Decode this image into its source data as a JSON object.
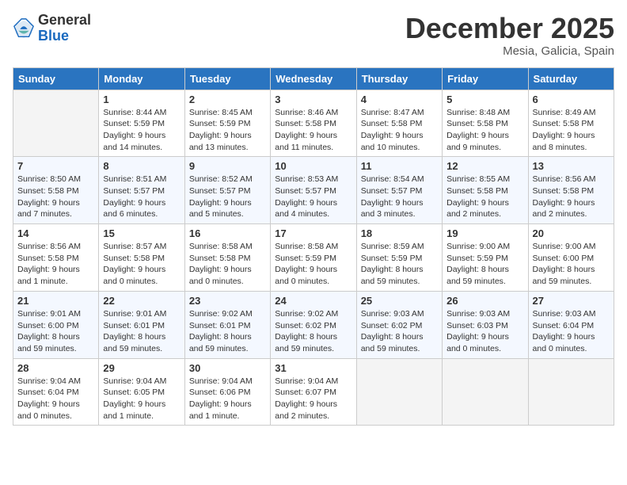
{
  "logo": {
    "general": "General",
    "blue": "Blue"
  },
  "title": "December 2025",
  "location": "Mesia, Galicia, Spain",
  "days_of_week": [
    "Sunday",
    "Monday",
    "Tuesday",
    "Wednesday",
    "Thursday",
    "Friday",
    "Saturday"
  ],
  "weeks": [
    [
      {
        "day": "",
        "info": ""
      },
      {
        "day": "1",
        "info": "Sunrise: 8:44 AM\nSunset: 5:59 PM\nDaylight: 9 hours\nand 14 minutes."
      },
      {
        "day": "2",
        "info": "Sunrise: 8:45 AM\nSunset: 5:59 PM\nDaylight: 9 hours\nand 13 minutes."
      },
      {
        "day": "3",
        "info": "Sunrise: 8:46 AM\nSunset: 5:58 PM\nDaylight: 9 hours\nand 11 minutes."
      },
      {
        "day": "4",
        "info": "Sunrise: 8:47 AM\nSunset: 5:58 PM\nDaylight: 9 hours\nand 10 minutes."
      },
      {
        "day": "5",
        "info": "Sunrise: 8:48 AM\nSunset: 5:58 PM\nDaylight: 9 hours\nand 9 minutes."
      },
      {
        "day": "6",
        "info": "Sunrise: 8:49 AM\nSunset: 5:58 PM\nDaylight: 9 hours\nand 8 minutes."
      }
    ],
    [
      {
        "day": "7",
        "info": "Sunrise: 8:50 AM\nSunset: 5:58 PM\nDaylight: 9 hours\nand 7 minutes."
      },
      {
        "day": "8",
        "info": "Sunrise: 8:51 AM\nSunset: 5:57 PM\nDaylight: 9 hours\nand 6 minutes."
      },
      {
        "day": "9",
        "info": "Sunrise: 8:52 AM\nSunset: 5:57 PM\nDaylight: 9 hours\nand 5 minutes."
      },
      {
        "day": "10",
        "info": "Sunrise: 8:53 AM\nSunset: 5:57 PM\nDaylight: 9 hours\nand 4 minutes."
      },
      {
        "day": "11",
        "info": "Sunrise: 8:54 AM\nSunset: 5:57 PM\nDaylight: 9 hours\nand 3 minutes."
      },
      {
        "day": "12",
        "info": "Sunrise: 8:55 AM\nSunset: 5:58 PM\nDaylight: 9 hours\nand 2 minutes."
      },
      {
        "day": "13",
        "info": "Sunrise: 8:56 AM\nSunset: 5:58 PM\nDaylight: 9 hours\nand 2 minutes."
      }
    ],
    [
      {
        "day": "14",
        "info": "Sunrise: 8:56 AM\nSunset: 5:58 PM\nDaylight: 9 hours\nand 1 minute."
      },
      {
        "day": "15",
        "info": "Sunrise: 8:57 AM\nSunset: 5:58 PM\nDaylight: 9 hours\nand 0 minutes."
      },
      {
        "day": "16",
        "info": "Sunrise: 8:58 AM\nSunset: 5:58 PM\nDaylight: 9 hours\nand 0 minutes."
      },
      {
        "day": "17",
        "info": "Sunrise: 8:58 AM\nSunset: 5:59 PM\nDaylight: 9 hours\nand 0 minutes."
      },
      {
        "day": "18",
        "info": "Sunrise: 8:59 AM\nSunset: 5:59 PM\nDaylight: 8 hours\nand 59 minutes."
      },
      {
        "day": "19",
        "info": "Sunrise: 9:00 AM\nSunset: 5:59 PM\nDaylight: 8 hours\nand 59 minutes."
      },
      {
        "day": "20",
        "info": "Sunrise: 9:00 AM\nSunset: 6:00 PM\nDaylight: 8 hours\nand 59 minutes."
      }
    ],
    [
      {
        "day": "21",
        "info": "Sunrise: 9:01 AM\nSunset: 6:00 PM\nDaylight: 8 hours\nand 59 minutes."
      },
      {
        "day": "22",
        "info": "Sunrise: 9:01 AM\nSunset: 6:01 PM\nDaylight: 8 hours\nand 59 minutes."
      },
      {
        "day": "23",
        "info": "Sunrise: 9:02 AM\nSunset: 6:01 PM\nDaylight: 8 hours\nand 59 minutes."
      },
      {
        "day": "24",
        "info": "Sunrise: 9:02 AM\nSunset: 6:02 PM\nDaylight: 8 hours\nand 59 minutes."
      },
      {
        "day": "25",
        "info": "Sunrise: 9:03 AM\nSunset: 6:02 PM\nDaylight: 8 hours\nand 59 minutes."
      },
      {
        "day": "26",
        "info": "Sunrise: 9:03 AM\nSunset: 6:03 PM\nDaylight: 9 hours\nand 0 minutes."
      },
      {
        "day": "27",
        "info": "Sunrise: 9:03 AM\nSunset: 6:04 PM\nDaylight: 9 hours\nand 0 minutes."
      }
    ],
    [
      {
        "day": "28",
        "info": "Sunrise: 9:04 AM\nSunset: 6:04 PM\nDaylight: 9 hours\nand 0 minutes."
      },
      {
        "day": "29",
        "info": "Sunrise: 9:04 AM\nSunset: 6:05 PM\nDaylight: 9 hours\nand 1 minute."
      },
      {
        "day": "30",
        "info": "Sunrise: 9:04 AM\nSunset: 6:06 PM\nDaylight: 9 hours\nand 1 minute."
      },
      {
        "day": "31",
        "info": "Sunrise: 9:04 AM\nSunset: 6:07 PM\nDaylight: 9 hours\nand 2 minutes."
      },
      {
        "day": "",
        "info": ""
      },
      {
        "day": "",
        "info": ""
      },
      {
        "day": "",
        "info": ""
      }
    ]
  ]
}
